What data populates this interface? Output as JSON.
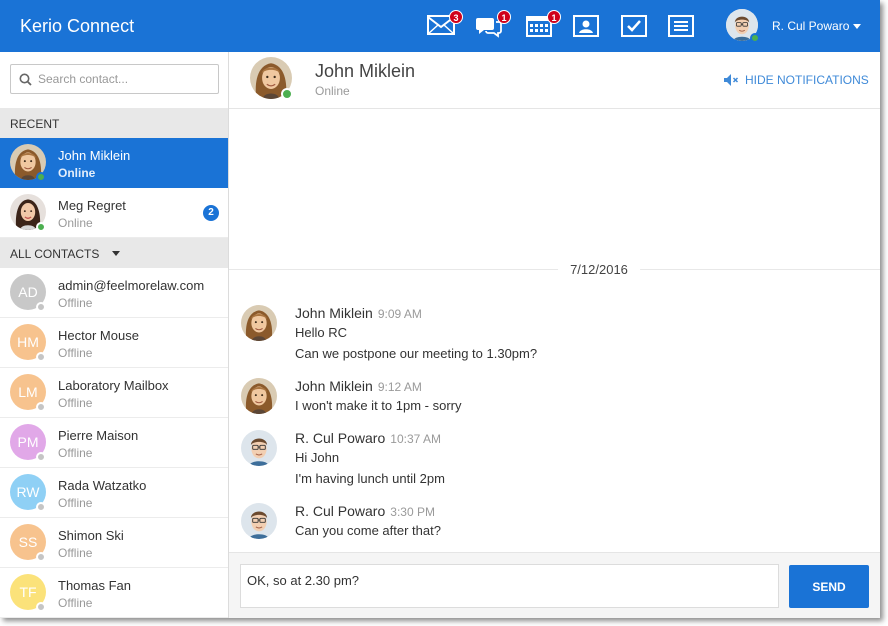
{
  "app": {
    "brand": "Kerio Connect"
  },
  "topbar": {
    "nav": [
      {
        "name": "mail",
        "icon": "envelope-icon",
        "badge": "3"
      },
      {
        "name": "chat",
        "icon": "chat-bubbles-icon",
        "badge": "1"
      },
      {
        "name": "calendar",
        "icon": "calendar-icon",
        "badge": "1"
      },
      {
        "name": "contacts",
        "icon": "contacts-card-icon",
        "badge": ""
      },
      {
        "name": "tasks",
        "icon": "checkbox-icon",
        "badge": ""
      },
      {
        "name": "notes",
        "icon": "notes-icon",
        "badge": ""
      }
    ],
    "user": {
      "name": "R. Cul Powaro",
      "status": "online"
    }
  },
  "sidebar": {
    "search_placeholder": "Search contact...",
    "recent_label": "RECENT",
    "all_label": "ALL CONTACTS",
    "recent": [
      {
        "name": "John Miklein",
        "status": "Online",
        "active": true,
        "unread": ""
      },
      {
        "name": "Meg Regret",
        "status": "Online",
        "active": false,
        "unread": "2"
      }
    ],
    "contacts": [
      {
        "initials": "AD",
        "name": "admin@feelmorelaw.com",
        "status": "Offline",
        "color": "#c8c8c8"
      },
      {
        "initials": "HM",
        "name": "Hector Mouse",
        "status": "Offline",
        "color": "#f7c38e"
      },
      {
        "initials": "LM",
        "name": "Laboratory Mailbox",
        "status": "Offline",
        "color": "#f7c38e"
      },
      {
        "initials": "PM",
        "name": "Pierre Maison",
        "status": "Offline",
        "color": "#e1a8e8"
      },
      {
        "initials": "RW",
        "name": "Rada Watzatko",
        "status": "Offline",
        "color": "#8fd0f5"
      },
      {
        "initials": "SS",
        "name": "Shimon Ski",
        "status": "Offline",
        "color": "#f7c38e"
      },
      {
        "initials": "TF",
        "name": "Thomas Fan",
        "status": "Offline",
        "color": "#fbe27a"
      }
    ]
  },
  "chat": {
    "contact_name": "John Miklein",
    "contact_status": "Online",
    "hide_notifications": "HIDE NOTIFICATIONS",
    "date": "7/12/2016",
    "messages": [
      {
        "sender": "John Miklein",
        "time": "9:09 AM",
        "lines": [
          "Hello RC",
          "Can we postpone our meeting to 1.30pm?"
        ]
      },
      {
        "sender": "John Miklein",
        "time": "9:12 AM",
        "lines": [
          "I won't make it to 1pm - sorry"
        ]
      },
      {
        "sender": "R. Cul Powaro",
        "time": "10:37 AM",
        "lines": [
          "Hi John",
          "I'm having lunch until 2pm"
        ]
      },
      {
        "sender": "R. Cul Powaro",
        "time": "3:30 PM",
        "lines": [
          "Can you come after that?"
        ]
      }
    ],
    "compose_value": "OK, so at 2.30 pm?",
    "send_label": "SEND"
  },
  "colors": {
    "accent": "#1a73d6",
    "online": "#4caf50",
    "badge": "#d0021b"
  }
}
